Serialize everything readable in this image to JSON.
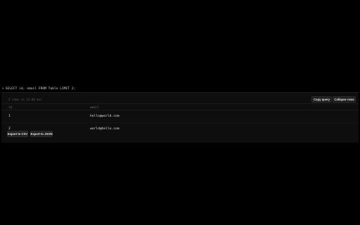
{
  "query": {
    "prompt": ">",
    "text": "SELECT id, email FROM Table LIMIT 2;"
  },
  "results": {
    "meta": "2 rows in (3.04 ms)",
    "copy_label": "Copy query",
    "collapse_label": "Collapse rows",
    "columns": [
      "id",
      "email"
    ],
    "rows": [
      {
        "id": "1",
        "email": "hello@world.com"
      },
      {
        "id": "2",
        "email": "world@hello.com"
      }
    ],
    "export_csv_label": "Export to CSV",
    "export_json_label": "Export to JSON"
  }
}
